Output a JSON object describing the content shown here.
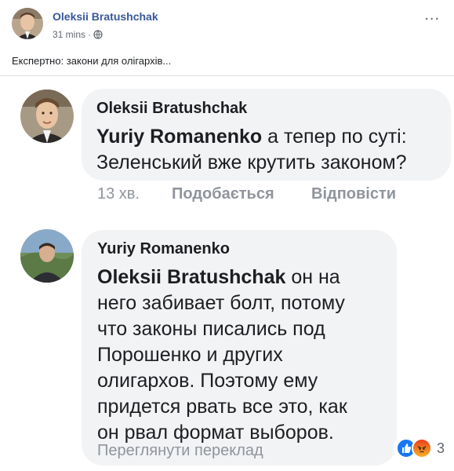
{
  "post": {
    "author": "Oleksii Bratushchak",
    "time": "31 mins",
    "separator": "·",
    "menu_icon": "...",
    "text": "Експертно: закони для олігархів..."
  },
  "comments": [
    {
      "author": "Oleksii Bratushchak",
      "mention": "Yuriy Romanenko",
      "text_line1": " а тепер по суті:",
      "text_line2": "Зеленський вже крутить законом?",
      "time": "13 хв.",
      "like_label": "Подобається",
      "reply_label": "Відповісти"
    },
    {
      "author": "Yuriy Romanenko",
      "mention": "Oleksii Bratushchak",
      "text_line1": "  он на",
      "text_lines": [
        "него забивает болт, потому",
        "что законы писались под",
        "Порошенко и других",
        "олигархов. Поэтому ему",
        "придется рвать все это, как",
        "он рвал формат выборов."
      ],
      "translate_label": "Переглянути переклад",
      "reaction_count": "3",
      "reaction_icons": [
        "like-icon",
        "angry-icon"
      ]
    }
  ]
}
